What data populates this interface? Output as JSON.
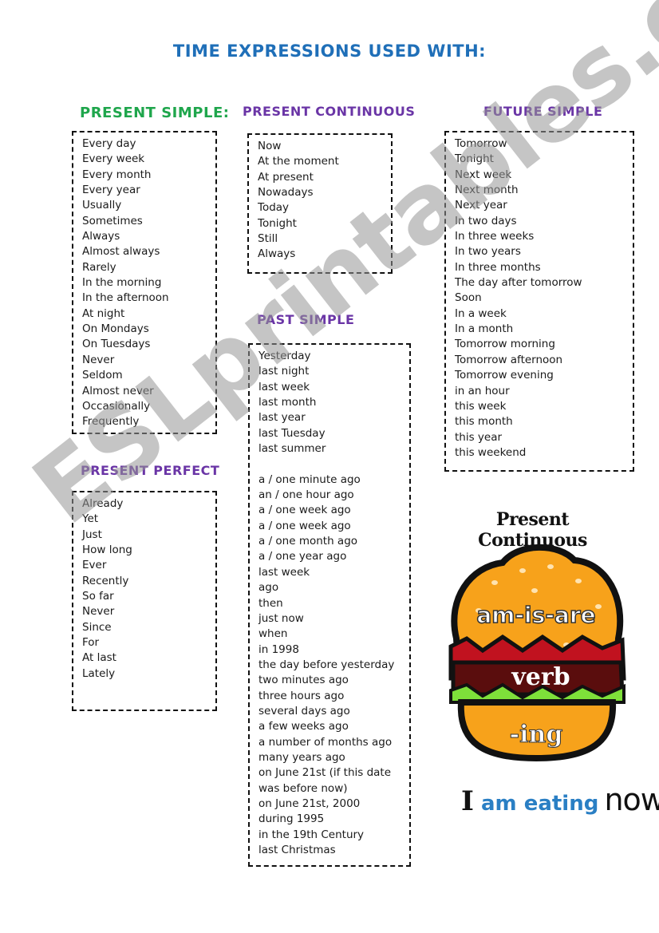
{
  "title": "TIME EXPRESSIONS USED WITH:",
  "colors": {
    "title": "#1f6fb8",
    "present_simple_heading": "#1fa64c",
    "other_headings": "#6a35a6",
    "caption_accent": "#2a7fc4"
  },
  "sections": {
    "present_simple": {
      "heading": "PRESENT SIMPLE:",
      "items": [
        "Every day",
        "Every week",
        "Every month",
        "Every year",
        "Usually",
        "Sometimes",
        "Always",
        "Almost always",
        "Rarely",
        "In the morning",
        "In the afternoon",
        "At night",
        "On Mondays",
        "On Tuesdays",
        "Never",
        "Seldom",
        "Almost never",
        "Occasionally",
        "Frequently"
      ]
    },
    "present_continuous": {
      "heading": "PRESENT CONTINUOUS",
      "items": [
        "Now",
        "At the moment",
        "At present",
        "Nowadays",
        "Today",
        "Tonight",
        "Still",
        "Always"
      ]
    },
    "future_simple": {
      "heading": "FUTURE SIMPLE",
      "items": [
        "Tomorrow",
        "Tonight",
        "Next week",
        "Next month",
        "Next year",
        "In two days",
        "In three weeks",
        "In two years",
        "In three months",
        "The day after tomorrow",
        "Soon",
        "In a week",
        "In a month",
        "Tomorrow  morning",
        "Tomorrow afternoon",
        "Tomorrow evening",
        "in an hour",
        "this week",
        "this month",
        "this year",
        "this weekend"
      ]
    },
    "past_simple": {
      "heading": "PAST SIMPLE",
      "items_a": [
        "Yesterday",
        "last night",
        "last week",
        "last month",
        "last year",
        "last Tuesday",
        "last summer"
      ],
      "items_b": [
        "a / one minute ago",
        "an / one hour ago",
        "a / one week ago",
        "a / one week ago",
        "a / one month ago",
        "a / one year ago",
        "last week",
        "ago",
        "then",
        "just now",
        "when",
        "in 1998",
        "the day before yesterday",
        "two minutes ago",
        "three hours ago",
        "several days ago",
        "a few weeks ago",
        "a number of months ago",
        "many years ago",
        "on June 21st (if this date",
        "was before now)",
        "on June 21st, 2000",
        "during 1995",
        "in the 19th Century",
        "last Christmas"
      ]
    },
    "present_perfect": {
      "heading": "PRESENT PERFECT",
      "items": [
        "Already",
        "Yet",
        "Just",
        "How long",
        "Ever",
        "Recently",
        "So far",
        "Never",
        "Since",
        "For",
        "At last",
        "Lately"
      ]
    }
  },
  "illustration": {
    "title": "Present Continuous",
    "layers": [
      "am-is-are",
      "verb",
      "-ing"
    ],
    "caption": {
      "subject": "I",
      "verb_phrase": "am eating",
      "time": "now"
    }
  },
  "watermark": "ESLprintables.com"
}
